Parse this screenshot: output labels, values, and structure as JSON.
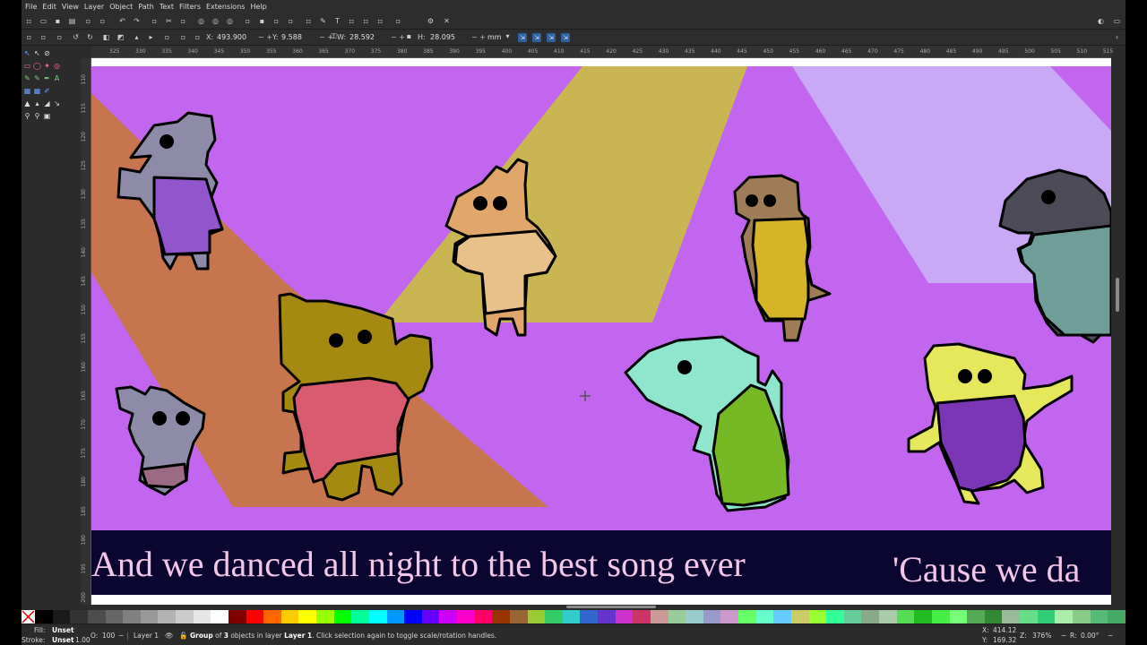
{
  "menubar": {
    "items": [
      "File",
      "Edit",
      "View",
      "Layer",
      "Object",
      "Path",
      "Text",
      "Filters",
      "Extensions",
      "Help"
    ]
  },
  "controls": {
    "x_label": "X:",
    "x_value": "493.900",
    "y_label": "Y:",
    "y_value": "9.588",
    "w_label": "W:",
    "w_value": "28.592",
    "h_label": "H:",
    "h_value": "28.095",
    "unit": "mm",
    "pm": "− +"
  },
  "ruler": {
    "h_ticks": [
      "325",
      "330",
      "335",
      "340",
      "345",
      "350",
      "355",
      "360",
      "365",
      "370",
      "375",
      "380",
      "385",
      "390",
      "395",
      "400",
      "405",
      "410",
      "415",
      "420",
      "425",
      "430",
      "435",
      "440",
      "445",
      "450",
      "455",
      "460",
      "465",
      "470",
      "475",
      "480",
      "485",
      "490",
      "495",
      "500",
      "505",
      "510",
      "515"
    ],
    "v_ticks": [
      "110",
      "115",
      "120",
      "125",
      "130",
      "135",
      "140",
      "145",
      "150",
      "155",
      "160",
      "165",
      "170",
      "175",
      "180",
      "185",
      "190",
      "195",
      "200"
    ]
  },
  "canvas": {
    "lyric_1": "And we danced all night to the best song ever",
    "lyric_2": "'Cause we da"
  },
  "palette": {
    "colors": [
      "#000000",
      "#1a1a1a",
      "#333333",
      "#4d4d4d",
      "#666666",
      "#808080",
      "#999999",
      "#b3b3b3",
      "#cccccc",
      "#e6e6e6",
      "#ffffff",
      "#800000",
      "#ff0000",
      "#ff6600",
      "#ffcc00",
      "#ffff00",
      "#99ff00",
      "#00ff00",
      "#00ff99",
      "#00ffff",
      "#0099ff",
      "#0000ff",
      "#6600ff",
      "#cc00ff",
      "#ff00cc",
      "#ff0066",
      "#993300",
      "#996633",
      "#99cc33",
      "#33cc66",
      "#33cccc",
      "#3366cc",
      "#6633cc",
      "#cc33cc",
      "#cc3366",
      "#cc9999",
      "#99cc99",
      "#99cccc",
      "#9999cc",
      "#cc99cc",
      "#66ff66",
      "#66ffcc",
      "#66ccff",
      "#cccc66",
      "#99ff33",
      "#33ff99",
      "#66cc99",
      "#88aa88",
      "#aaccaa",
      "#55dd55",
      "#22bb22",
      "#44ee44",
      "#77ff77",
      "#55aa55",
      "#338833",
      "#99bb99",
      "#66dd88",
      "#33cc77",
      "#aaeeaa",
      "#88cc88",
      "#55bb77",
      "#44aa66"
    ]
  },
  "status": {
    "fill_label": "Fill:",
    "fill_value": "Unset",
    "stroke_label": "Stroke:",
    "stroke_value": "Unset",
    "stroke_width": "1.00",
    "opacity_label": "O:",
    "opacity_value": "100",
    "layer_name": "Layer 1",
    "message_prefix": "Group",
    "message_mid": " of ",
    "message_count": "3",
    "message_rest1": " objects in layer ",
    "message_layer": "Layer 1",
    "message_rest2": ". Click selection again to toggle scale/rotation handles.",
    "cursor_x_label": "X:",
    "cursor_x": "414.12",
    "cursor_y_label": "Y:",
    "cursor_y": "169.32",
    "zoom_label": "Z:",
    "zoom": "376%",
    "rotation_label": "R:",
    "rotation": "0.00°"
  },
  "colors": {
    "ui_bg": "#2b2b2b",
    "canvas_purple": "#c266f0",
    "lyric_band": "#0a0630",
    "lyric_text": "#f2c6e6",
    "beam_orange": "#c7754f",
    "beam_yellow": "#c9b653",
    "beam_lavender": "#c9a8f5"
  }
}
